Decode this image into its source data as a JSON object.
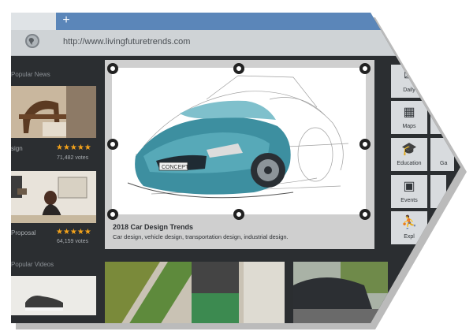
{
  "browser": {
    "new_tab_label": "+",
    "url": "http://www.livingfuturetrends.com"
  },
  "left_column": {
    "popular_news_label": "Popular News",
    "popular_videos_label": "Popular Videos",
    "items": [
      {
        "caption": "sign",
        "stars": "★★★★★",
        "votes": "71,482 votes"
      },
      {
        "caption": "Proposal",
        "stars": "★★★★★",
        "votes": "64,159 votes"
      }
    ]
  },
  "featured": {
    "title": "2018 Car Design Trends",
    "subtitle": "Car design, vehicle design, transportation design, industrial design."
  },
  "categories": [
    {
      "label": "Daily",
      "icon": "✉"
    },
    {
      "label": "Maps",
      "icon": "▦"
    },
    {
      "label": "Education",
      "icon": "🎓"
    },
    {
      "label": "Events",
      "icon": "▣"
    },
    {
      "label": "Expl",
      "icon": "⛹"
    },
    {
      "label": "Ga",
      "icon": ""
    }
  ],
  "colors": {
    "accent": "#5b86b9",
    "background": "#2b2e31",
    "stars": "#f4a31b"
  }
}
